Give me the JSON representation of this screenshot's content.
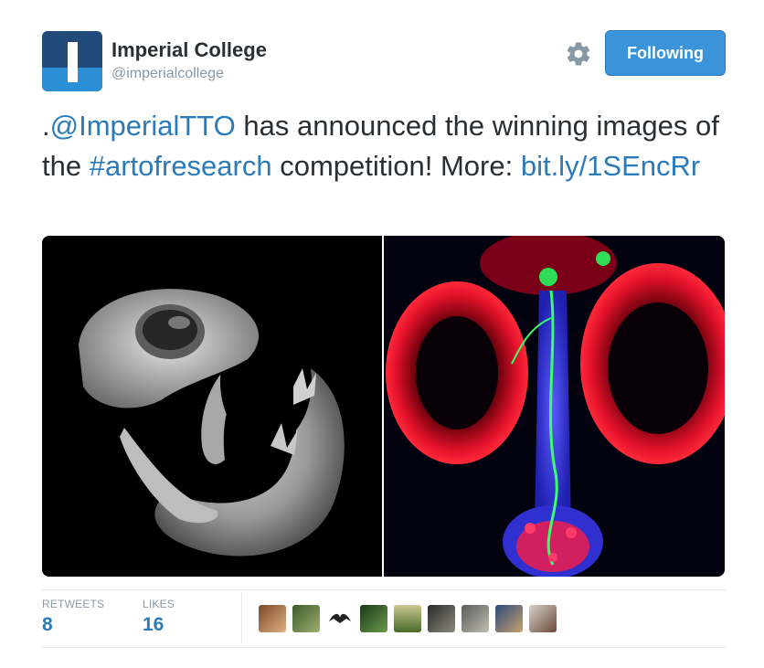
{
  "tweet": {
    "author": {
      "name": "Imperial College",
      "handle": "@imperialcollege",
      "avatar_icon": "imperial-logo-icon",
      "brand_color": "#1f4a7a"
    },
    "actions": {
      "settings_icon": "gear-icon",
      "follow_label": "Following",
      "follow_color": "#3b94d9"
    },
    "text": {
      "prefix": ".",
      "mention": "@ImperialTTO",
      "middle": " has announced the winning images of the ",
      "hashtag": "#artofresearch",
      "after_hashtag": " competition! More: ",
      "link": "bit.ly/1SEncRr"
    },
    "media": [
      {
        "description_icon": "embryo-xray-image"
      },
      {
        "description_icon": "fluorescent-microscopy-image"
      }
    ],
    "stats": {
      "retweets_label": "RETWEETS",
      "retweets": "8",
      "likes_label": "LIKES",
      "likes": "16"
    },
    "likers_count_shown": 9,
    "link_color": "#2b7bb9"
  }
}
